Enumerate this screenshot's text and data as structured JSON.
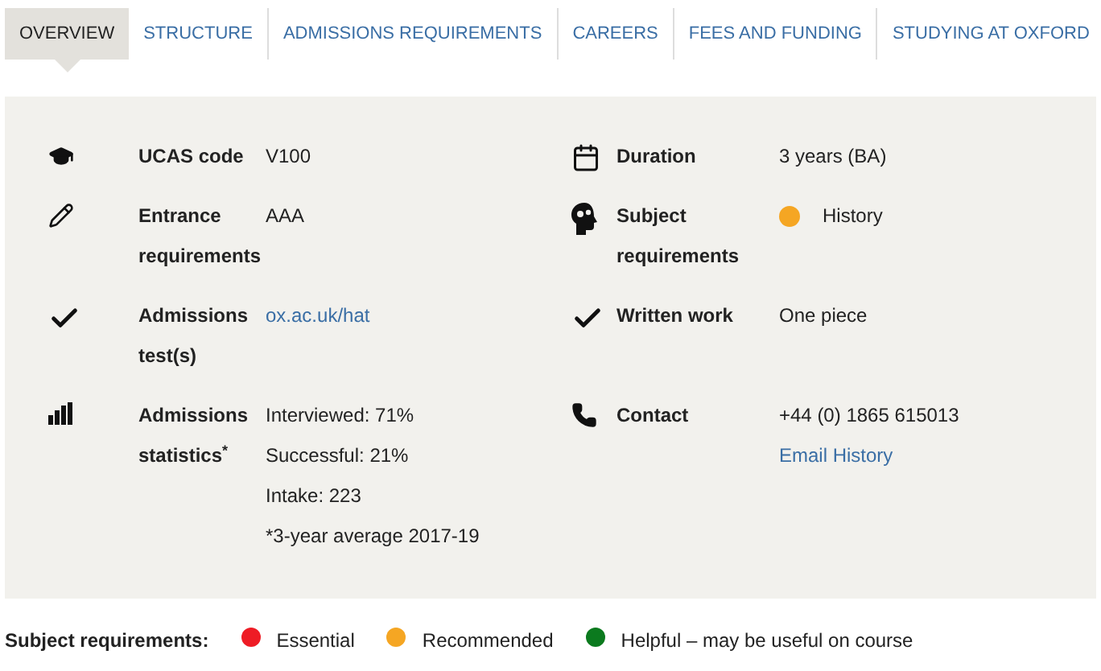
{
  "tabs": [
    {
      "label": "OVERVIEW",
      "selected": true
    },
    {
      "label": "STRUCTURE",
      "selected": false
    },
    {
      "label": "ADMISSIONS REQUIREMENTS",
      "selected": false
    },
    {
      "label": "CAREERS",
      "selected": false
    },
    {
      "label": "FEES AND FUNDING",
      "selected": false
    },
    {
      "label": "STUDYING AT OXFORD",
      "selected": false
    }
  ],
  "rows": [
    {
      "cells": [
        {
          "label": "UCAS code",
          "values": [
            {
              "kind": "text",
              "text": "V100"
            }
          ]
        },
        {
          "label": "Duration",
          "values": [
            {
              "kind": "text",
              "text": "3 years (BA)"
            }
          ]
        }
      ]
    },
    {
      "cells": [
        {
          "label": "Entrance requirements",
          "values": [
            {
              "kind": "text",
              "text": "AAA"
            }
          ]
        },
        {
          "label": "Subject requirements",
          "values": [
            {
              "kind": "dot",
              "text": "History",
              "color": "#f5a623"
            }
          ]
        }
      ]
    },
    {
      "cells": [
        {
          "label": "Admissions test(s)",
          "values": [
            {
              "kind": "link",
              "text": "ox.ac.uk/hat"
            }
          ]
        },
        {
          "label": "Written work",
          "values": [
            {
              "kind": "text",
              "text": "One piece"
            }
          ]
        }
      ]
    },
    {
      "cells": [
        {
          "label": "Admissions statistics$^{*}$",
          "values": [
            {
              "kind": "text",
              "text": "Interviewed: 71%"
            },
            {
              "kind": "text",
              "text": "Successful: 21%"
            },
            {
              "kind": "text",
              "text": "Intake: 223"
            },
            {
              "kind": "note",
              "text": "*3-year average 2017-19"
            }
          ]
        },
        {
          "label": "Contact",
          "values": [
            {
              "kind": "text",
              "text": "+44 (0) 1865 615013"
            },
            {
              "kind": "link",
              "text": "Email History"
            }
          ]
        }
      ]
    }
  ],
  "legend": {
    "title": "Subject requirements:",
    "items": [
      {
        "label": "Essential",
        "color": "#ee1c25"
      },
      {
        "label": "Recommended",
        "color": "#f5a623"
      },
      {
        "label": "Helpful – may be useful on course",
        "color": "#0b7a1e"
      }
    ]
  }
}
